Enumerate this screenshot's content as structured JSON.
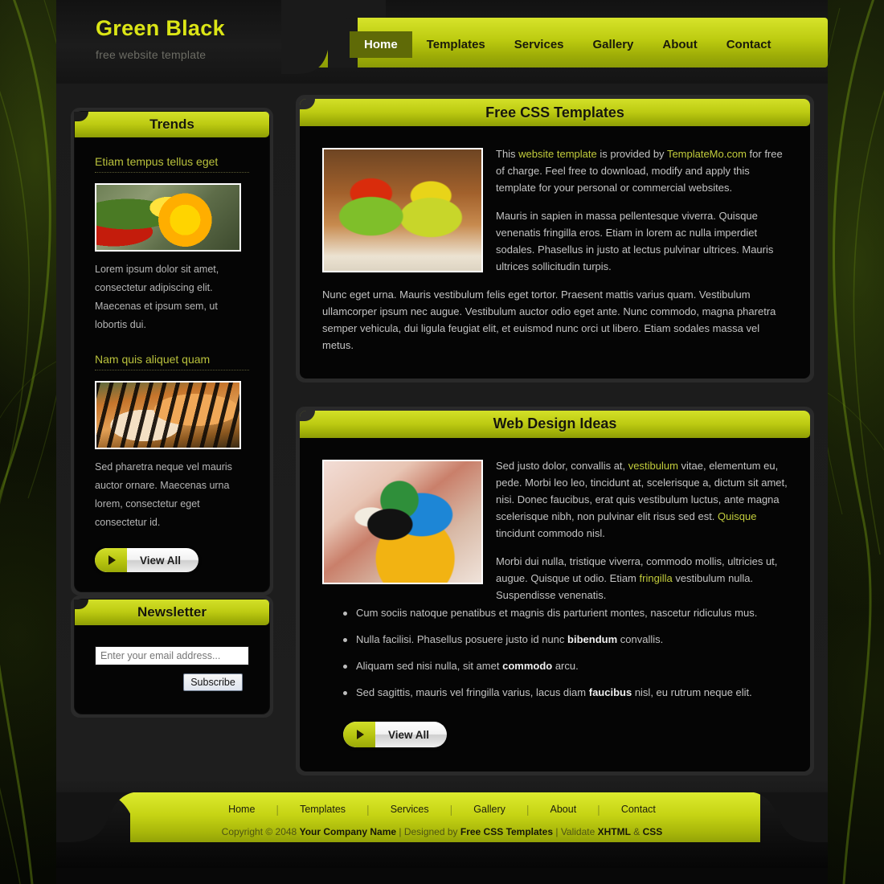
{
  "header": {
    "logo_title": "Green Black",
    "logo_subtitle": "free website template",
    "nav": [
      {
        "label": "Home",
        "active": true
      },
      {
        "label": "Templates",
        "active": false
      },
      {
        "label": "Services",
        "active": false
      },
      {
        "label": "Gallery",
        "active": false
      },
      {
        "label": "About",
        "active": false
      },
      {
        "label": "Contact",
        "active": false
      }
    ]
  },
  "sidebar": {
    "trends": {
      "title": "Trends",
      "items": [
        {
          "heading": "Etiam tempus tellus eget",
          "image": "yellow-orchid-flower-photo",
          "text": "Lorem ipsum dolor sit amet, consectetur adipiscing elit. Maecenas et ipsum sem, ut lobortis dui."
        },
        {
          "heading": "Nam quis aliquet quam",
          "image": "tiger-cub-photo",
          "text": "Sed pharetra neque vel mauris auctor ornare. Maecenas urna lorem, consectetur eget consectetur id."
        }
      ],
      "view_all_label": "View All"
    },
    "newsletter": {
      "title": "Newsletter",
      "email_placeholder": "Enter your email address...",
      "email_value": "",
      "submit_label": "Subscribe"
    }
  },
  "content": {
    "templates_panel": {
      "title": "Free CSS Templates",
      "image": "red-yellow-cactus-photo",
      "paragraphs": [
        {
          "runs": [
            {
              "t": "This "
            },
            {
              "t": "website template",
              "style": "link"
            },
            {
              "t": " is provided by "
            },
            {
              "t": "TemplateMo.com",
              "style": "link"
            },
            {
              "t": " for free of charge. Feel free to download, modify and apply this template for your personal or commercial websites."
            }
          ]
        },
        {
          "runs": [
            {
              "t": "Mauris in sapien in massa pellentesque viverra. Quisque venenatis fringilla eros. Etiam in lorem ac nulla imperdiet sodales. Phasellus in justo at lectus pulvinar ultrices. Mauris ultrices sollicitudin turpis."
            }
          ]
        },
        {
          "runs": [
            {
              "t": "Nunc eget urna. Mauris vestibulum felis eget tortor. Praesent mattis varius quam. Vestibulum ullamcorper ipsum nec augue. Vestibulum auctor odio eget ante. Nunc commodo, magna pharetra semper vehicula, dui ligula feugiat elit, et euismod nunc orci ut libero. Etiam sodales massa vel metus."
            }
          ]
        }
      ]
    },
    "ideas_panel": {
      "title": "Web Design Ideas",
      "image": "blue-gold-macaw-parrot-photo",
      "paragraphs": [
        {
          "runs": [
            {
              "t": "Sed justo dolor, convallis at, "
            },
            {
              "t": "vestibulum",
              "style": "link"
            },
            {
              "t": " vitae, elementum eu, pede. Morbi leo leo, tincidunt at, scelerisque a, dictum sit amet, nisi. Donec faucibus, erat quis vestibulum luctus, ante magna scelerisque nibh, non pulvinar elit risus sed est. "
            },
            {
              "t": "Quisque",
              "style": "link"
            },
            {
              "t": " tincidunt commodo nisl."
            }
          ]
        },
        {
          "runs": [
            {
              "t": "Morbi dui nulla, tristique viverra, commodo mollis, ultricies ut, augue. Quisque ut odio. Etiam "
            },
            {
              "t": "fringilla",
              "style": "link"
            },
            {
              "t": " vestibulum nulla. Suspendisse venenatis."
            }
          ]
        }
      ],
      "bullets": [
        {
          "runs": [
            {
              "t": "Cum sociis natoque penatibus et magnis dis parturient montes, nascetur ridiculus mus."
            }
          ]
        },
        {
          "runs": [
            {
              "t": "Nulla facilisi. Phasellus posuere justo id nunc "
            },
            {
              "t": "bibendum",
              "style": "bold"
            },
            {
              "t": " convallis."
            }
          ]
        },
        {
          "runs": [
            {
              "t": "Aliquam sed nisi nulla, sit amet "
            },
            {
              "t": "commodo",
              "style": "bold"
            },
            {
              "t": " arcu."
            }
          ]
        },
        {
          "runs": [
            {
              "t": "Sed sagittis, mauris vel fringilla varius, lacus diam "
            },
            {
              "t": "faucibus",
              "style": "bold"
            },
            {
              "t": " nisl, eu rutrum neque elit."
            }
          ]
        }
      ],
      "view_all_label": "View All"
    }
  },
  "footer": {
    "nav": [
      "Home",
      "Templates",
      "Services",
      "Gallery",
      "About",
      "Contact"
    ],
    "separator": "|",
    "copyright": {
      "runs": [
        {
          "t": "Copyright © 2048 "
        },
        {
          "t": "Your Company Name",
          "style": "bold"
        },
        {
          "t": " | Designed by "
        },
        {
          "t": "Free CSS Templates",
          "style": "bold"
        },
        {
          "t": " | Validate "
        },
        {
          "t": "XHTML",
          "style": "bold"
        },
        {
          "t": " & "
        },
        {
          "t": "CSS",
          "style": "bold"
        }
      ]
    }
  },
  "colors": {
    "accent_green": "#bdcb12",
    "accent_light": "#d3e028",
    "logo_yellow": "#dbe516",
    "panel_black": "#050505",
    "panel_gray": "#2a2a2a",
    "nav_active_bg": "#5f6a07",
    "body_text": "#c3c3c3",
    "link_green": "#c2cc3c"
  }
}
